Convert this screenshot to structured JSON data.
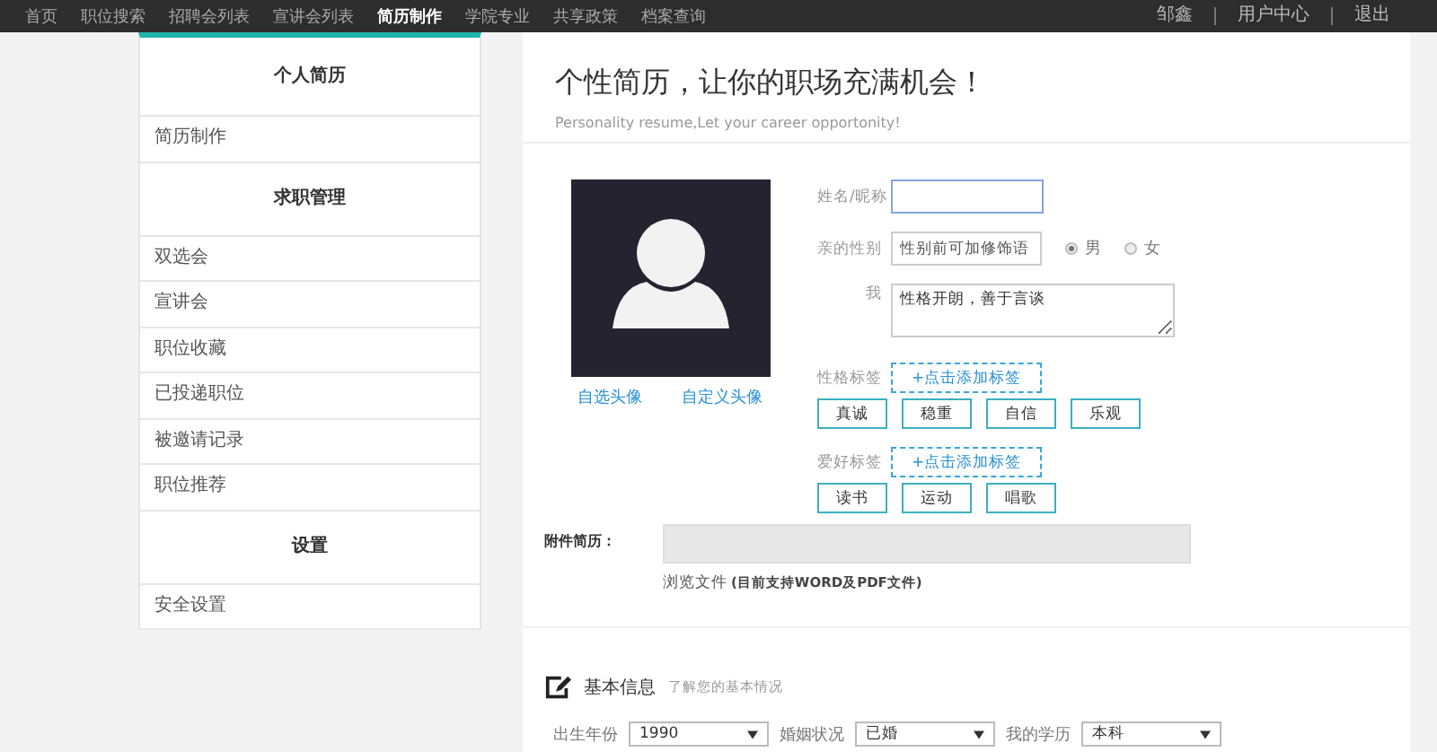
{
  "nav": {
    "items": [
      {
        "label": "首页",
        "selected": false
      },
      {
        "label": "职位搜索",
        "selected": false
      },
      {
        "label": "招聘会列表",
        "selected": false
      },
      {
        "label": "宣讲会列表",
        "selected": false
      },
      {
        "label": "简历制作",
        "selected": true
      },
      {
        "label": "学院专业",
        "selected": false
      },
      {
        "label": "共享政策",
        "selected": false
      },
      {
        "label": "档案查询",
        "selected": false
      }
    ],
    "user_links": [
      "邹鑫",
      "用户中心",
      "退出"
    ]
  },
  "sidebar": {
    "sections": [
      {
        "title": "个人简历",
        "items": [
          "简历制作"
        ]
      },
      {
        "title": "求职管理",
        "items": [
          "双选会",
          "宣讲会",
          "职位收藏",
          "已投递职位",
          "被邀请记录",
          "职位推荐"
        ]
      },
      {
        "title": "设置",
        "items": [
          "安全设置"
        ]
      }
    ]
  },
  "main": {
    "title": "个性简历，让你的职场充满机会！",
    "subtitle": "Personality resume,Let your career opportonity!",
    "avatar_links": [
      "自选头像",
      "自定义头像"
    ],
    "name_field": {
      "label": "姓名/昵称"
    },
    "gender": {
      "label": "亲的性别",
      "placeholder": "性别前可加修饰语",
      "options": [
        {
          "label": "男",
          "selected": true
        },
        {
          "label": "女",
          "selected": false
        }
      ]
    },
    "about": {
      "label": "我",
      "value": "性格开朗，善于言谈"
    },
    "tag_groups": [
      {
        "label": "性格标签",
        "add_button": "+点击添加标签",
        "tags": [
          "真诚",
          "稳重",
          "自信",
          "乐观"
        ]
      },
      {
        "label": "爱好标签",
        "add_button": "+点击添加标签",
        "tags": [
          "读书",
          "运动",
          "唱歌"
        ]
      }
    ],
    "attachment": {
      "label": "附件简历：",
      "browse": "浏览文件",
      "note": "(目前支持WORD及PDF文件)"
    },
    "basic_info": {
      "title": "基本信息",
      "subtitle": "了解您的基本情况",
      "selects": [
        {
          "label": "出生年份",
          "value": "1990"
        },
        {
          "label": "婚姻状况",
          "value": "已婚"
        },
        {
          "label": "我的学历",
          "value": "本科"
        }
      ]
    }
  }
}
